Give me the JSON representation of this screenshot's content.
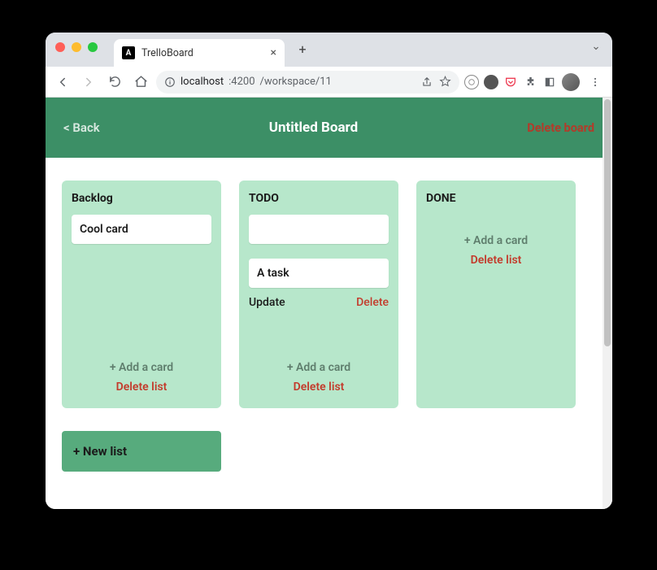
{
  "tab": {
    "title": "TrelloBoard",
    "favicon_letter": "A"
  },
  "address": {
    "host": "localhost",
    "port": ":4200",
    "path": "/workspace/11"
  },
  "header": {
    "back_label": "< Back",
    "title": "Untitled Board",
    "delete_label": "Delete board"
  },
  "lists": [
    {
      "title": "Backlog",
      "cards": [
        {
          "text": "Cool card"
        }
      ],
      "add_label": "+ Add a card",
      "delete_label": "Delete list"
    },
    {
      "title": "TODO",
      "editing": {
        "input_value": "",
        "card_text": "A task",
        "update_label": "Update",
        "delete_label": "Delete"
      },
      "add_label": "+ Add a card",
      "delete_label": "Delete list"
    },
    {
      "title": "DONE",
      "cards": [],
      "add_label": "+ Add a card",
      "delete_label": "Delete list"
    }
  ],
  "new_list_label": "+ New list"
}
